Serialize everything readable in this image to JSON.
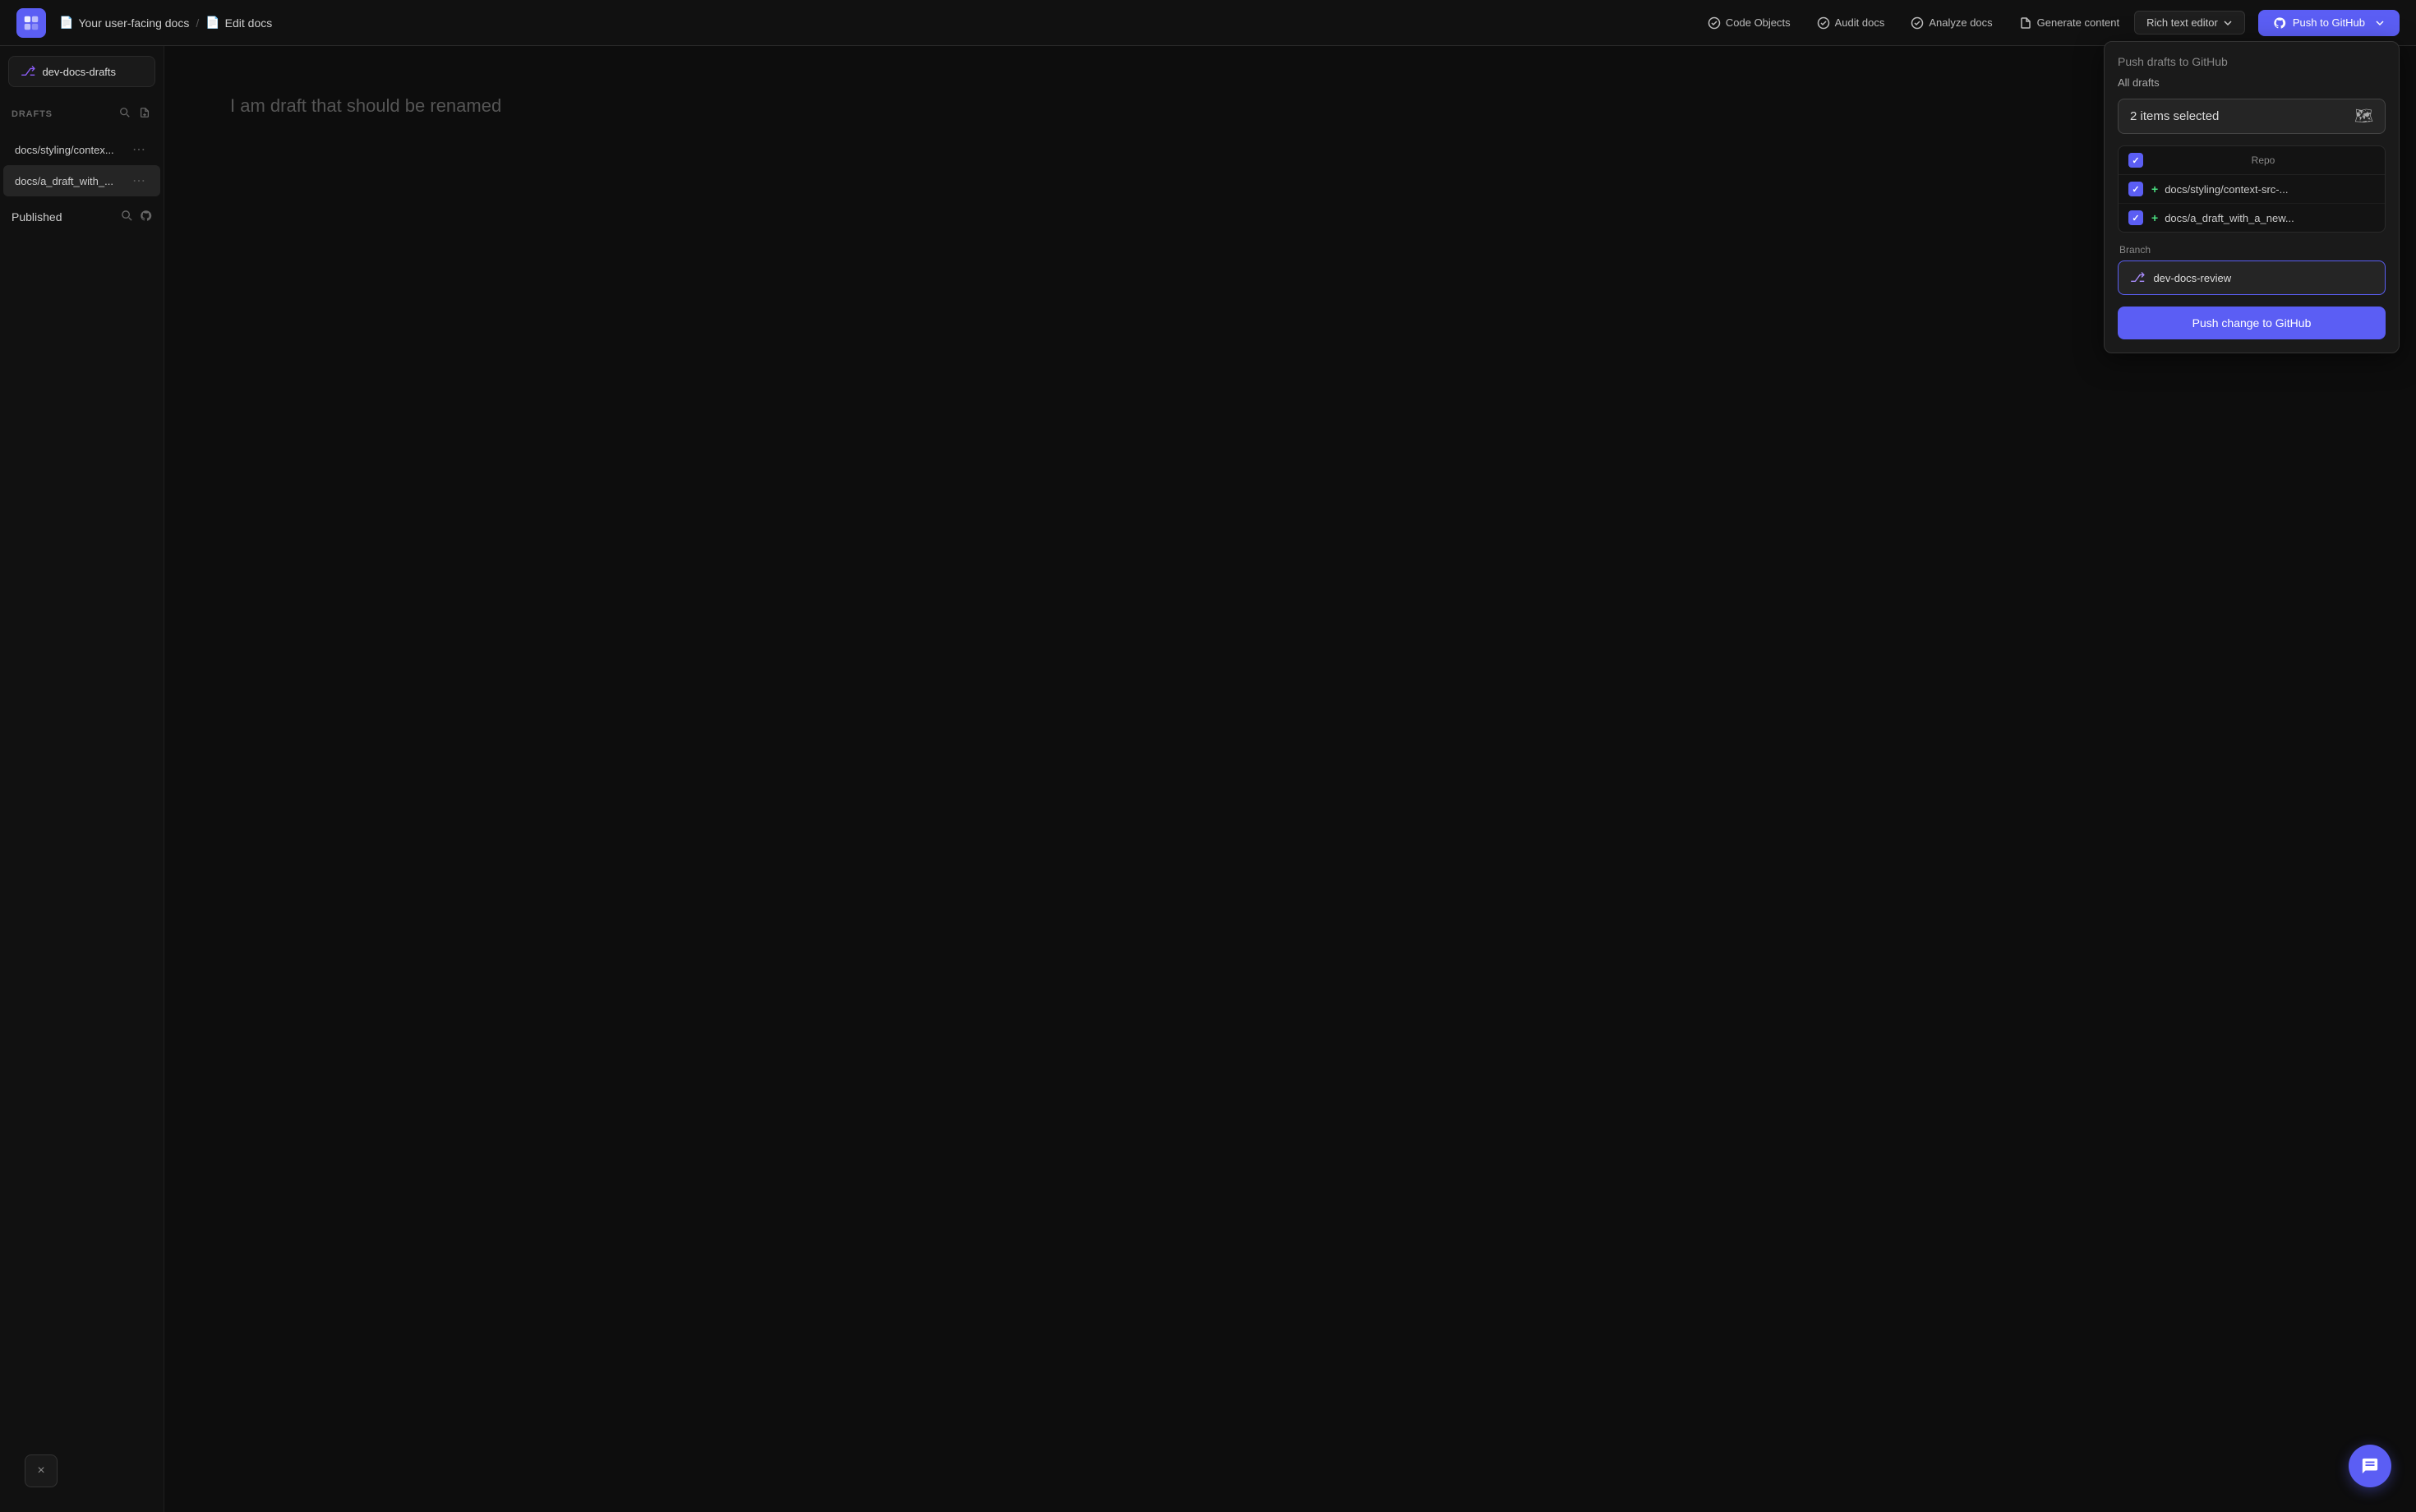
{
  "header": {
    "logo_alt": "App logo",
    "breadcrumb": {
      "doc_icon": "📄",
      "parent": "Your user-facing docs",
      "separator": "/",
      "child_icon": "📄",
      "current": "Edit docs"
    },
    "nav": [
      {
        "id": "code-objects",
        "label": "Code Objects",
        "icon": "check-circle"
      },
      {
        "id": "audit-docs",
        "label": "Audit docs",
        "icon": "check-circle"
      },
      {
        "id": "analyze-docs",
        "label": "Analyze docs",
        "icon": "check-circle"
      },
      {
        "id": "generate-content",
        "label": "Generate content",
        "icon": "file"
      }
    ],
    "rich_text_editor": "Rich text editor",
    "push_to_github": "Push to GitHub"
  },
  "sidebar": {
    "repo_name": "dev-docs-drafts",
    "drafts_label": "DRAFTS",
    "search_tooltip": "Search",
    "new_file_tooltip": "New file",
    "items": [
      {
        "id": "item1",
        "label": "docs/styling/contex..."
      },
      {
        "id": "item2",
        "label": "docs/a_draft_with_..."
      }
    ],
    "published_label": "Published"
  },
  "main": {
    "draft_placeholder": "I am draft that should be renamed"
  },
  "dropdown": {
    "header": "Push drafts to GitHub",
    "all_drafts": "All drafts",
    "items_selected": "2 items selected",
    "repo_col_label": "Repo",
    "files": [
      {
        "id": "f1",
        "name": "docs/styling/context-src-..."
      },
      {
        "id": "f2",
        "name": "docs/a_draft_with_a_new..."
      }
    ],
    "branch_label": "Branch",
    "branch_name": "dev-docs-review",
    "push_button": "Push change to GitHub"
  },
  "bottom": {
    "close_label": "×",
    "chat_label": "💬"
  }
}
